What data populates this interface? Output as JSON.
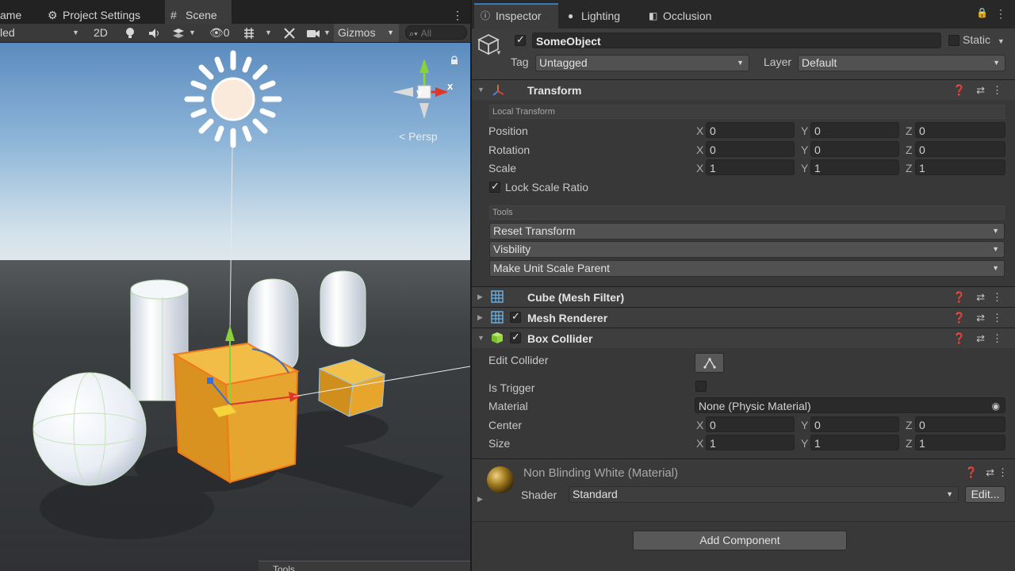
{
  "scene_tabs": {
    "game_partial": "ame",
    "project_settings": "Project Settings",
    "scene": "Scene",
    "more": "⋮"
  },
  "scene_toolbar": {
    "shading_partial": "led",
    "mode_2d": "2D",
    "hidden_count": "0",
    "gizmos": "Gizmos",
    "search_placeholder": "All"
  },
  "scene_view": {
    "gizmo_axis_y": "y",
    "gizmo_axis_x": "x",
    "projection": "< Persp",
    "tools_overlay": "Tools"
  },
  "inspector_tabs": {
    "inspector": "Inspector",
    "lighting": "Lighting",
    "occlusion": "Occlusion"
  },
  "object": {
    "name": "SomeObject",
    "static_label": "Static",
    "tag_label": "Tag",
    "tag_value": "Untagged",
    "layer_label": "Layer",
    "layer_value": "Default"
  },
  "transform": {
    "title": "Transform",
    "local_section": "Local Transform",
    "rows": [
      {
        "label": "Position",
        "x": "0",
        "y": "0",
        "z": "0"
      },
      {
        "label": "Rotation",
        "x": "0",
        "y": "0",
        "z": "0"
      },
      {
        "label": "Scale",
        "x": "1",
        "y": "1",
        "z": "1"
      }
    ],
    "axis_labels": [
      "X",
      "Y",
      "Z"
    ],
    "lock_scale": "Lock Scale Ratio",
    "tools_section": "Tools",
    "tool_dropdowns": [
      "Reset Transform",
      "Visbility",
      "Make Unit Scale Parent"
    ]
  },
  "components": {
    "mesh_filter": "Cube (Mesh Filter)",
    "mesh_renderer": "Mesh Renderer",
    "box_collider": "Box Collider"
  },
  "box_collider": {
    "edit_collider": "Edit Collider",
    "is_trigger": "Is Trigger",
    "material_label": "Material",
    "material_value": "None (Physic Material)",
    "center_label": "Center",
    "center": {
      "x": "0",
      "y": "0",
      "z": "0"
    },
    "size_label": "Size",
    "size": {
      "x": "1",
      "y": "1",
      "z": "1"
    }
  },
  "material": {
    "name": "Non Blinding White (Material)",
    "shader_label": "Shader",
    "shader_value": "Standard",
    "edit_button": "Edit..."
  },
  "add_component": "Add Component",
  "colors": {
    "selection_orange": "#f07a1a",
    "cube_fill": "#e5a52f",
    "accent_blue": "#3a79bb"
  }
}
